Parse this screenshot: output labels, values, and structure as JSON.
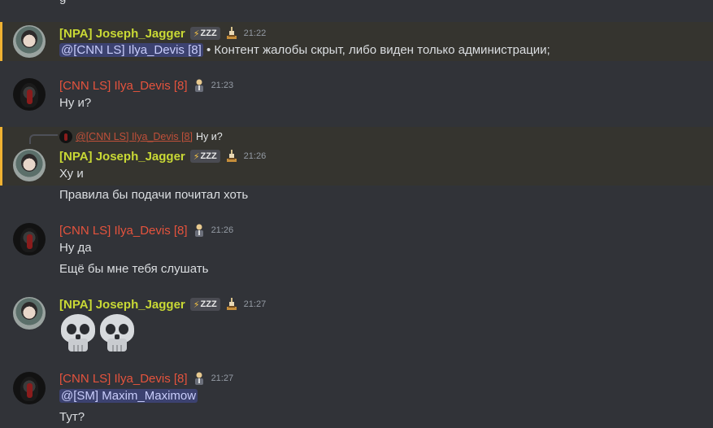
{
  "top_cut_text": "g",
  "users": {
    "jj": {
      "name": "[NPA] Joseph_Jagger",
      "tag_text": "ZZZ",
      "color": "#c9d935"
    },
    "id": {
      "name": "[CNN LS] Ilya_Devis [8]",
      "color": "#e5533d"
    }
  },
  "messages": [
    {
      "time": "21:22",
      "mention": "@[CNN LS] Ilya_Devis [8]",
      "text": " • Контент жалобы скрыт, либо виден только администрации;"
    },
    {
      "time": "21:23",
      "lines": [
        "Ну и?"
      ]
    },
    {
      "reply_name": "@[CNN LS] Ilya_Devis [8]",
      "reply_text": "Ну и?",
      "time": "21:26",
      "lines": [
        "Ху и",
        "Правила бы подачи почитал хоть"
      ]
    },
    {
      "time": "21:26",
      "lines": [
        "Ну да",
        "Ещё бы мне тебя слушать"
      ]
    },
    {
      "time": "21:27",
      "emoji": [
        "skull-icon",
        "skull-icon"
      ]
    },
    {
      "time": "21:27",
      "mention": "@[SM] Maxim_Maximow",
      "lines": [
        "Тут?"
      ]
    }
  ],
  "colors": {
    "background": "#313338",
    "highlight_bg": "#35342f",
    "highlight_border": "#f0b232",
    "mention_bg": "#3c4270"
  }
}
